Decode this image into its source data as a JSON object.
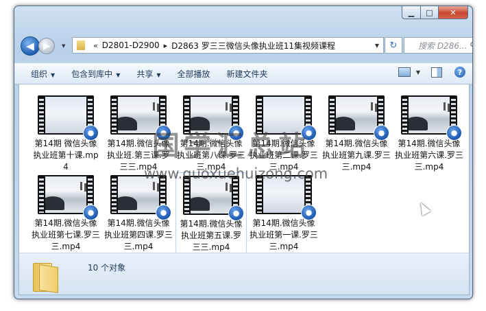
{
  "window": {
    "caption": {
      "minimize": "▁",
      "maximize": "□",
      "close": "✕"
    }
  },
  "nav": {
    "back_icon": "arrow-left",
    "forward_icon": "arrow-right",
    "address": {
      "chevron": "«",
      "crumbs": [
        "D2801-D2900",
        "D2863 罗三三微信头像执业班11集视频课程"
      ],
      "separator": "▸"
    },
    "search_placeholder": "搜索 D286..."
  },
  "toolbar": {
    "organize": "组织",
    "include_in_library": "包含到库中",
    "share": "共享",
    "play_all": "全部播放",
    "new_folder": "新建文件夹"
  },
  "files": [
    {
      "name": "第14期 微信头像执业班第十课.mp4",
      "thumb": "plain",
      "selected": false
    },
    {
      "name": "第14期.微信头像执业班.第三课.罗三三.mp4",
      "thumb": "scene",
      "selected": false
    },
    {
      "name": "第14期.微信头像执业班第八课.罗三三.mp4",
      "thumb": "scene",
      "selected": false
    },
    {
      "name": "第14期.微信头像执业班第二课.罗三三.mp4",
      "thumb": "plain",
      "selected": false
    },
    {
      "name": "第14期.微信头像执业班第九课.罗三三.mp4",
      "thumb": "scene",
      "selected": false
    },
    {
      "name": "第14期.微信头像执业班第六课.罗三三.mp4",
      "thumb": "scene",
      "selected": false
    },
    {
      "name": "第14期.微信头像执业班第七课.罗三三.mp4",
      "thumb": "scene",
      "selected": false
    },
    {
      "name": "第14期.微信头像执业班第四课.罗三三.mp4",
      "thumb": "scene",
      "selected": false
    },
    {
      "name": "第14期.微信头像执业班第五课.罗三三.mp4",
      "thumb": "scene",
      "selected": true
    },
    {
      "name": "第14期.微信头像执业班第一课.罗三三.mp4",
      "thumb": "plain",
      "selected": false
    }
  ],
  "status": {
    "count": "10 个对象"
  },
  "watermark": {
    "line1": "国学汇总站",
    "line2": "www.guoxuehuizong.com"
  },
  "colors": {
    "accent": "#1d5fb3",
    "chrome": "#b9d1ea"
  }
}
